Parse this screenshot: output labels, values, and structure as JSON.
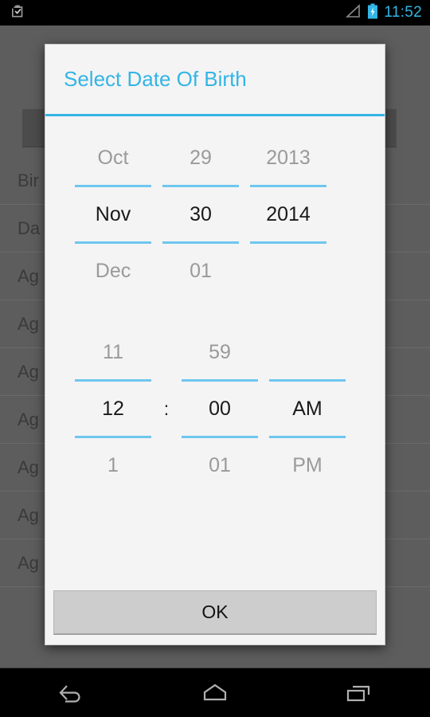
{
  "status_bar": {
    "notification_icon": "clipboard-check-icon",
    "signal_icon": "signal-empty-icon",
    "battery_icon": "battery-charging-icon",
    "clock": "11:52",
    "accent_color": "#33b5e5"
  },
  "background": {
    "rows": [
      "Bir",
      "Da",
      "Ag",
      "Ag",
      "Ag",
      "Ag",
      "Ag",
      "Ag",
      "Ag"
    ]
  },
  "dialog": {
    "title": "Select Date Of Birth",
    "title_color": "#33b5e5",
    "accent_line_color": "#6ec6ef",
    "date_picker": {
      "month": {
        "previous": "Oct",
        "current": "Nov",
        "next": "Dec"
      },
      "day": {
        "previous": "29",
        "current": "30",
        "next": "01"
      },
      "year": {
        "previous": "2013",
        "current": "2014",
        "next": ""
      }
    },
    "time_picker": {
      "hour": {
        "previous": "11",
        "current": "12",
        "next": "1"
      },
      "separator": ":",
      "minute": {
        "previous": "59",
        "current": "00",
        "next": "01"
      },
      "meridiem": {
        "previous": "",
        "current": "AM",
        "next": "PM"
      }
    },
    "ok_label": "OK"
  },
  "nav_bar": {
    "back": "back-icon",
    "home": "home-icon",
    "recents": "recents-icon"
  }
}
